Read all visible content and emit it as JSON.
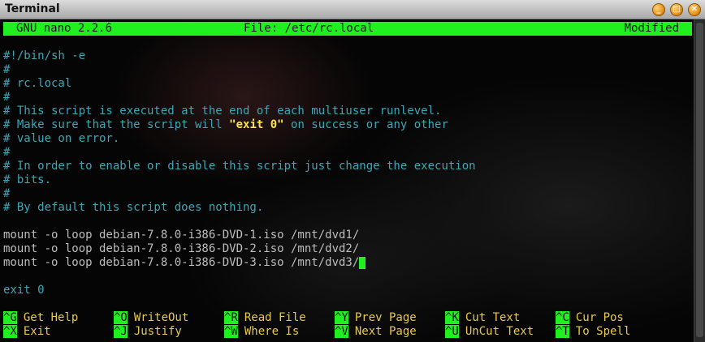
{
  "window": {
    "title": "Terminal"
  },
  "nano": {
    "version": "GNU nano 2.2.6",
    "file": "File: /etc/rc.local",
    "status": "Modified"
  },
  "editor": {
    "lines": [
      "#!/bin/sh -e",
      "#",
      "# rc.local",
      "#",
      "# This script is executed at the end of each multiuser runlevel.",
      "# Make sure that the script will ",
      "\"exit 0\"",
      " on success or any other",
      "# value on error.",
      "#",
      "# In order to enable or disable this script just change the execution",
      "# bits.",
      "#",
      "# By default this script does nothing.",
      "mount -o loop debian-7.8.0-i386-DVD-1.iso /mnt/dvd1/",
      "mount -o loop debian-7.8.0-i386-DVD-2.iso /mnt/dvd2/",
      "mount -o loop debian-7.8.0-i386-DVD-3.iso /mnt/dvd3/",
      "exit 0"
    ]
  },
  "shortcuts": [
    {
      "key": "^G",
      "label": "Get Help"
    },
    {
      "key": "^O",
      "label": "WriteOut"
    },
    {
      "key": "^R",
      "label": "Read File"
    },
    {
      "key": "^Y",
      "label": "Prev Page"
    },
    {
      "key": "^K",
      "label": "Cut Text"
    },
    {
      "key": "^C",
      "label": "Cur Pos"
    },
    {
      "key": "^X",
      "label": "Exit"
    },
    {
      "key": "^J",
      "label": "Justify"
    },
    {
      "key": "^W",
      "label": "Where Is"
    },
    {
      "key": "^V",
      "label": "Next Page"
    },
    {
      "key": "^U",
      "label": "UnCut Text"
    },
    {
      "key": "^T",
      "label": "To Spell"
    }
  ],
  "colors": {
    "nano_bar": "#20f020",
    "comment": "#3ba7b7",
    "highlight": "#ffe14a",
    "shortcut_label": "#e8c94a"
  }
}
